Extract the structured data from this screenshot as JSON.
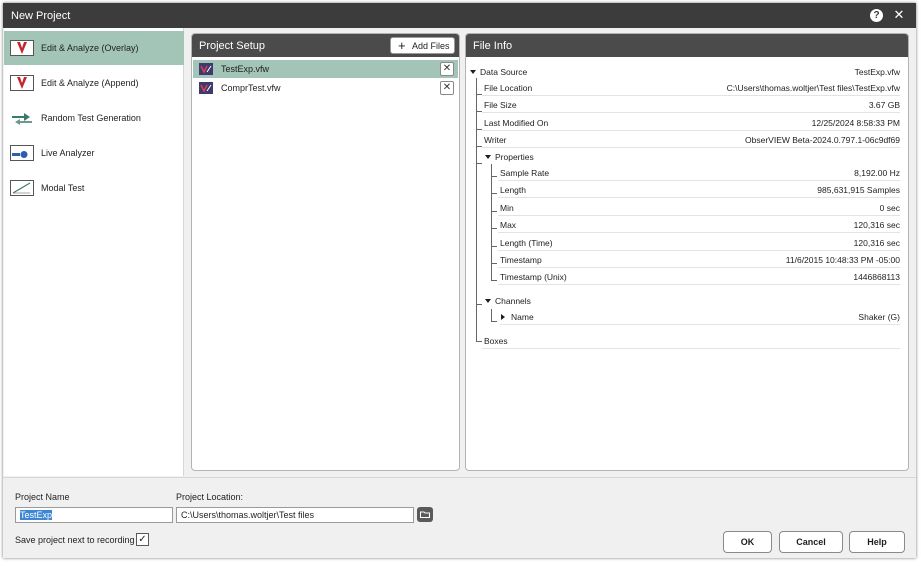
{
  "window": {
    "title": "New Project",
    "help_icon": "help-icon",
    "close_label": "✕"
  },
  "sidebar": {
    "items": [
      {
        "label": "Edit & Analyze (Overlay)",
        "active": true,
        "icon": "overlay-icon"
      },
      {
        "label": "Edit & Analyze (Append)",
        "active": false,
        "icon": "append-icon"
      },
      {
        "label": "Random Test Generation",
        "active": false,
        "icon": "random-test-icon"
      },
      {
        "label": "Live Analyzer",
        "active": false,
        "icon": "live-analyzer-icon"
      },
      {
        "label": "Modal Test",
        "active": false,
        "icon": "modal-test-icon"
      }
    ]
  },
  "project_setup": {
    "title": "Project Setup",
    "add_files_label": "Add Files",
    "files": [
      {
        "name": "TestExp.vfw",
        "selected": true
      },
      {
        "name": "ComprTest.vfw",
        "selected": false
      }
    ],
    "remove_label": "✕"
  },
  "file_info": {
    "title": "File Info",
    "data_source": {
      "label": "Data Source",
      "value": "TestExp.vfw"
    },
    "file_location": {
      "label": "File Location",
      "value": "C:\\Users\\thomas.woltjer\\Test files\\TestExp.vfw"
    },
    "file_size": {
      "label": "File Size",
      "value": "3.67 GB"
    },
    "last_modified": {
      "label": "Last Modified On",
      "value": "12/25/2024 8:58:33 PM"
    },
    "writer": {
      "label": "Writer",
      "value": "ObserVIEW Beta-2024.0.797.1-06c9df69"
    },
    "properties": {
      "label": "Properties",
      "items": [
        {
          "label": "Sample Rate",
          "value": "8,192.00 Hz"
        },
        {
          "label": "Length",
          "value": "985,631,915 Samples"
        },
        {
          "label": "Min",
          "value": "0 sec"
        },
        {
          "label": "Max",
          "value": "120,316 sec"
        },
        {
          "label": "Length (Time)",
          "value": "120,316 sec"
        },
        {
          "label": "Timestamp",
          "value": "11/6/2015 10:48:33 PM -05:00"
        },
        {
          "label": "Timestamp (Unix)",
          "value": "1446868113"
        }
      ]
    },
    "channels": {
      "label": "Channels",
      "name": {
        "label": "Name",
        "value": "Shaker (G)"
      }
    },
    "boxes": {
      "label": "Boxes"
    }
  },
  "bottom": {
    "project_name_label": "Project Name",
    "project_name_value": "TestExp",
    "project_location_label": "Project Location:",
    "project_location_value": "C:\\Users\\thomas.woltjer\\Test files",
    "save_next_label": "Save project next to recording",
    "save_next_checked": true,
    "check_mark": "✓",
    "ok_label": "OK",
    "cancel_label": "Cancel",
    "help_label": "Help"
  },
  "colors": {
    "titlebar": "#3c3c3c",
    "panel_header": "#4b4b4b",
    "selection": "#a2c5b8",
    "accent_red": "#c4262e",
    "text_selection": "#3d86d4"
  }
}
